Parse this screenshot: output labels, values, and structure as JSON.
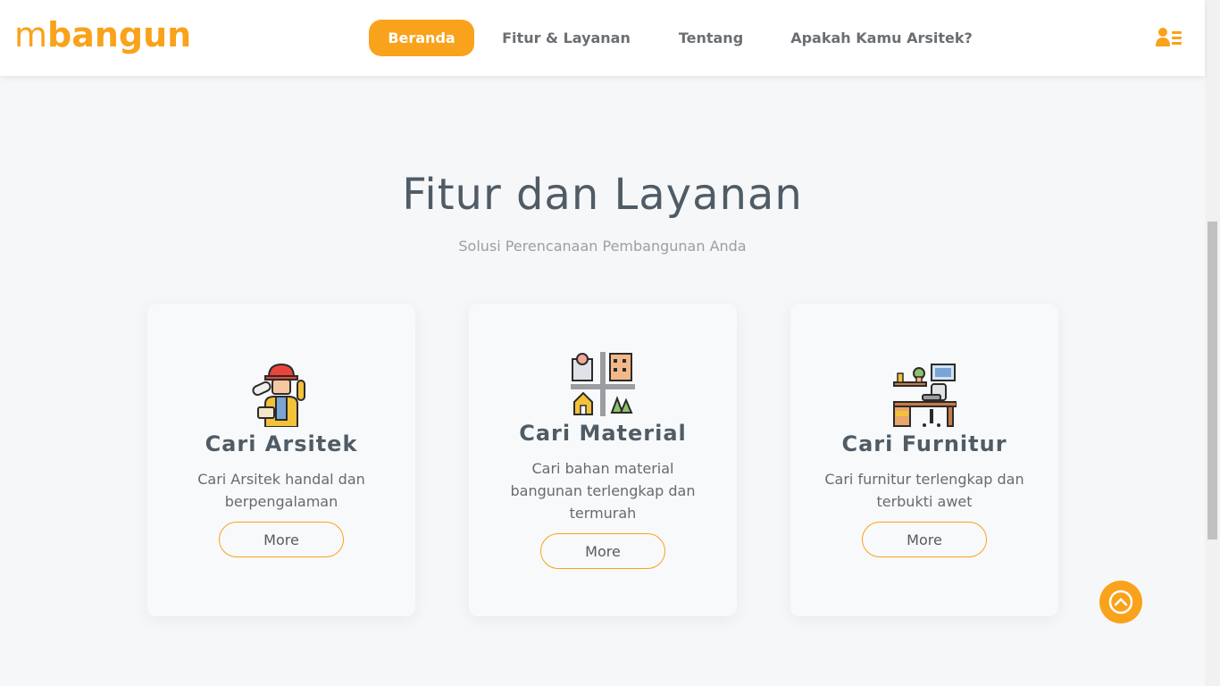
{
  "header": {
    "logo_light": "m",
    "logo_bold": "bangun",
    "nav": [
      {
        "label": "Beranda",
        "active": true
      },
      {
        "label": "Fitur & Layanan",
        "active": false
      },
      {
        "label": "Tentang",
        "active": false
      },
      {
        "label": "Apakah Kamu Arsitek?",
        "active": false
      }
    ],
    "user_icon": "user-list-icon"
  },
  "section": {
    "title": "Fitur dan Layanan",
    "subtitle": "Solusi Perencanaan Pembangunan Anda"
  },
  "cards": [
    {
      "icon": "architect-worker-icon",
      "title": "Cari Arsitek",
      "desc": "Cari Arsitek handal dan berpengalaman",
      "button": "More"
    },
    {
      "icon": "city-map-icon",
      "title": "Cari Material",
      "desc": "Cari bahan material bangunan terlengkap dan termurah",
      "button": "More"
    },
    {
      "icon": "furniture-desk-icon",
      "title": "Cari Furnitur",
      "desc": "Cari furnitur terlengkap dan terbukti awet",
      "button": "More"
    }
  ],
  "colors": {
    "accent": "#f9a21b",
    "heading": "#4f5c66",
    "background": "#f6f7f9"
  }
}
